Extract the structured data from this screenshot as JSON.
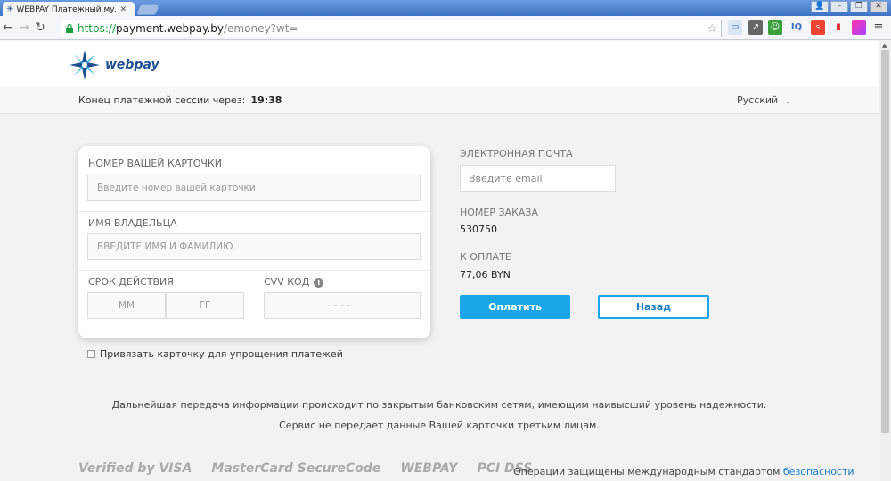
{
  "browser": {
    "tab_title": "WEBPAY Платежный мульт",
    "url_https": "https://",
    "url_host": "payment.webpay.by",
    "url_path": "/emoney?wt="
  },
  "header": {
    "logo_text": "webpay",
    "session_label": "Конец платежной сессии через:",
    "session_time": "19:38",
    "language": "Русский"
  },
  "card_form": {
    "card_number_label": "НОМЕР ВАШЕЙ КАРТОЧКИ",
    "card_number_placeholder": "Введите номер вашей карточки",
    "holder_label": "ИМЯ ВЛАДЕЛЬЦА",
    "holder_placeholder": "ВВЕДИТЕ ИМЯ И ФАМИЛИЮ",
    "expiry_label": "СРОК ДЕЙСТВИЯ",
    "month_placeholder": "ММ",
    "year_placeholder": "ГГ",
    "cvv_label": "CVV КОД",
    "cvv_placeholder": "- - -",
    "save_card_label": "Привязать карточку для упрощения платежей"
  },
  "order": {
    "email_label": "ЭЛЕКТРОННАЯ ПОЧТА",
    "email_placeholder": "Введите email",
    "order_label": "НОМЕР ЗАКАЗА",
    "order_number": "530750",
    "amount_label": "К ОПЛАТЕ",
    "amount": "77,06 BYN",
    "pay_button": "Оплатить",
    "back_button": "Назад"
  },
  "notes": {
    "line1": "Дальнейшая передача информации происходит по закрытым банковским сетям, имеющим наивысший уровень надежности.",
    "line2": "Сервис не передает данные Вашей карточки третьим лицам."
  },
  "footer": {
    "logos": [
      "Verified by VISA",
      "MasterCard SecureCode",
      "WEBPAY",
      "PCI DSS"
    ],
    "security_text": "Операции защищены международным стандартом",
    "security_link": "безопасности"
  },
  "colors": {
    "accent": "#1aa6e8",
    "brand": "#1d4f91"
  }
}
